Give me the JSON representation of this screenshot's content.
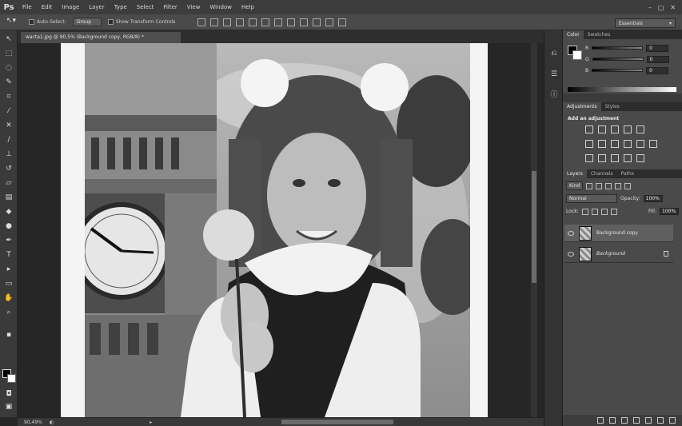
{
  "app": {
    "logo": "Ps"
  },
  "menu": [
    "File",
    "Edit",
    "Image",
    "Layer",
    "Type",
    "Select",
    "Filter",
    "View",
    "Window",
    "Help"
  ],
  "window_controls": [
    "–",
    "□",
    "✕"
  ],
  "options_bar": {
    "auto_select_label": "Auto-Select:",
    "auto_select_value": "Group",
    "show_transform_label": "Show Transform Controls",
    "workspace": "Essentials"
  },
  "document": {
    "tab_label": "wacta1.jpg @ 90,5% (Background copy, RGB/8) *",
    "zoom": "90,49%"
  },
  "color_panel": {
    "tabs": [
      "Color",
      "Swatches"
    ],
    "channels": [
      {
        "label": "R",
        "value": "0"
      },
      {
        "label": "G",
        "value": "0"
      },
      {
        "label": "B",
        "value": "0"
      }
    ]
  },
  "adjustments_panel": {
    "tabs": [
      "Adjustments",
      "Styles"
    ],
    "title": "Add an adjustment"
  },
  "layers_panel": {
    "tabs": [
      "Layers",
      "Channels",
      "Paths"
    ],
    "kind_filter": "Kind",
    "blend_mode": "Normal",
    "opacity_label": "Opacity:",
    "opacity_value": "100%",
    "lock_label": "Lock:",
    "fill_label": "Fill:",
    "fill_value": "100%",
    "layers": [
      {
        "name": "Background copy",
        "selected": true,
        "locked": false
      },
      {
        "name": "Background",
        "selected": false,
        "locked": true
      }
    ]
  }
}
